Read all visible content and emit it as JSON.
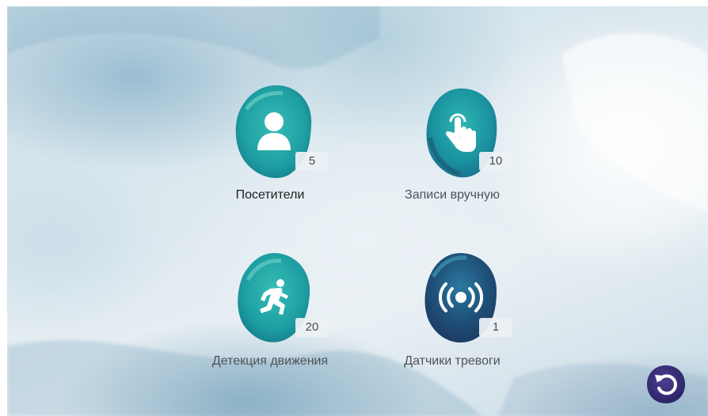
{
  "menu": {
    "items": [
      {
        "id": "visitors",
        "label": "Посетители",
        "count": "5",
        "icon": "person-icon",
        "active": true
      },
      {
        "id": "manual",
        "label": "Записи вручную",
        "count": "10",
        "icon": "touch-hand-icon",
        "active": false
      },
      {
        "id": "motion",
        "label": "Детекция движения",
        "count": "20",
        "icon": "running-man-icon",
        "active": false
      },
      {
        "id": "alarm",
        "label": "Датчики тревоги",
        "count": "1",
        "icon": "alarm-signal-icon",
        "active": false
      }
    ]
  },
  "back_button": {
    "icon": "back-arrow-icon"
  },
  "colors": {
    "teal": "#1fa6a6",
    "teal_light": "#3fc1bb",
    "navy": "#1f4d74",
    "back_button": "#3a2f7a",
    "text": "#4f5358",
    "text_active": "#1b1d20"
  }
}
